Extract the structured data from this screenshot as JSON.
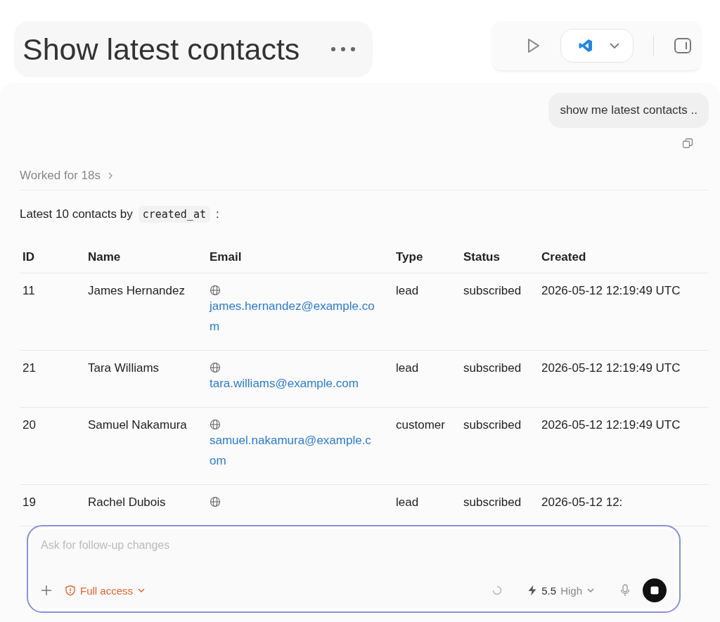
{
  "title": "Show latest contacts",
  "user_message": "show me latest contacts ..",
  "worked": "Worked for 18s",
  "intro": {
    "text": "Latest 10 contacts by",
    "code": "created_at",
    "after": ":"
  },
  "table": {
    "columns": [
      "ID",
      "Name",
      "Email",
      "Type",
      "Status",
      "Created"
    ],
    "rows": [
      {
        "id": "11",
        "name": "James Hernandez",
        "email": "james.hernandez@example.com",
        "type": "lead",
        "status": "subscribed",
        "created": "2026-05-12 12:19:49 UTC"
      },
      {
        "id": "21",
        "name": "Tara Williams",
        "email": "tara.williams@example.com",
        "type": "lead",
        "status": "subscribed",
        "created": "2026-05-12 12:19:49 UTC"
      },
      {
        "id": "20",
        "name": "Samuel Nakamura",
        "email": "samuel.nakamura@example.com",
        "type": "customer",
        "status": "subscribed",
        "created": "2026-05-12 12:19:49 UTC"
      },
      {
        "id": "19",
        "name": "Rachel Dubois",
        "type": "lead",
        "status": "subscribed",
        "created": "2026-05-12 12:"
      }
    ]
  },
  "composer": {
    "placeholder": "Ask for follow-up changes",
    "access": "Full access",
    "model": "5.5",
    "effort": "High"
  }
}
